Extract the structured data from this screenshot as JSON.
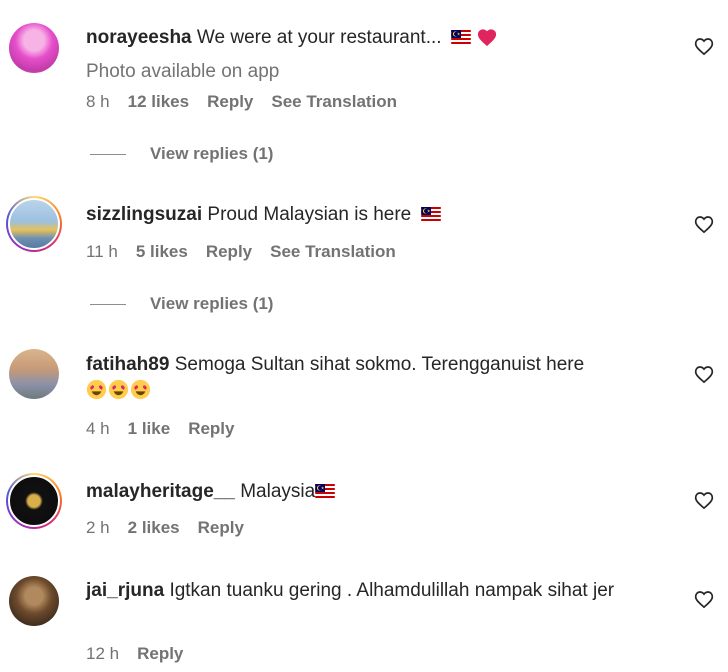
{
  "comments": [
    {
      "username": "norayeesha",
      "text": "We were at your restaurant...",
      "photo_note": "Photo available on app",
      "time": "8 h",
      "likes": "12 likes",
      "reply": "Reply",
      "translate": "See Translation",
      "view_replies": "View replies (1)"
    },
    {
      "username": "sizzlingsuzai",
      "text": "Proud Malaysian is here",
      "time": "11 h",
      "likes": "5 likes",
      "reply": "Reply",
      "translate": "See Translation",
      "view_replies": "View replies (1)"
    },
    {
      "username": "fatihah89",
      "text": "Semoga Sultan sihat sokmo. Terengganuist here",
      "time": "4 h",
      "likes": "1 like",
      "reply": "Reply"
    },
    {
      "username": "malayheritage__",
      "text": "Malaysia",
      "time": "2 h",
      "likes": "2 likes",
      "reply": "Reply"
    },
    {
      "username": "jai_rjuna",
      "text": "Igtkan tuanku gering . Alhamdulillah nampak sihat jer",
      "time": "12 h",
      "reply": "Reply"
    }
  ],
  "icons": {
    "like": "heart-outline-icon",
    "flag": "malaysia-flag-emoji",
    "heart_emoji": "red-heart-emoji",
    "heart_eyes": "heart-eyes-emoji"
  },
  "colors": {
    "text": "#262626",
    "secondary": "#737373",
    "heart_emoji": "#e0245e"
  }
}
